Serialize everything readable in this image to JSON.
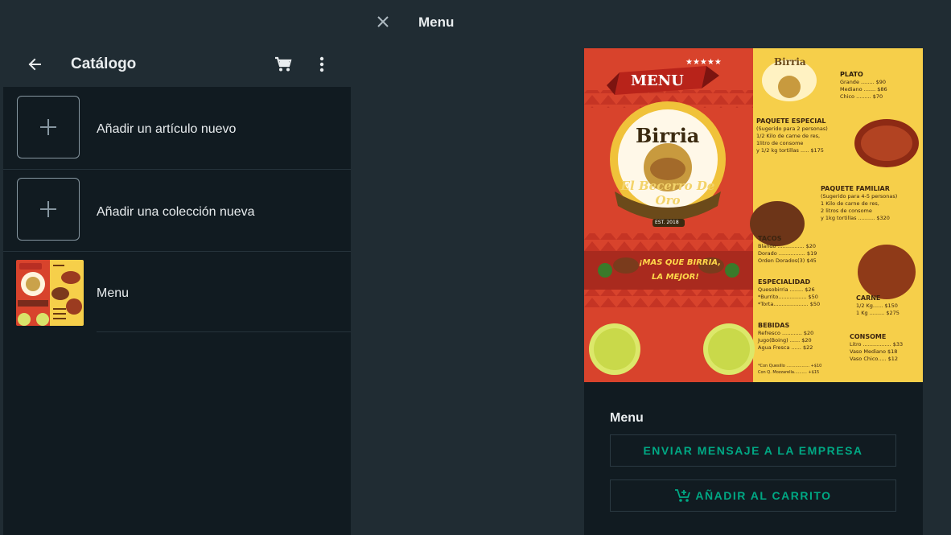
{
  "viewer": {
    "title": "Menu",
    "close_icon": "close-icon"
  },
  "catalog": {
    "title": "Catálogo",
    "back_icon": "arrow-left-icon",
    "cart_icon": "cart-icon",
    "more_icon": "more-vertical-icon",
    "items": [
      {
        "label": "Añadir un artículo nuevo",
        "icon": "plus-icon"
      },
      {
        "label": "Añadir una colección nueva",
        "icon": "plus-icon"
      },
      {
        "label": "Menu"
      }
    ]
  },
  "menu_image": {
    "banner": "MENU",
    "brand": "Birria",
    "brand_sub": "El Becerro De Oro",
    "est": "EST. 2018",
    "slogan_line1": "¡MAS QUE BIRRIA,",
    "slogan_line2": "LA MEJOR!",
    "plato_title": "PLATO",
    "plato_rows": [
      "Grande ........ $90",
      "Mediano ....... $86",
      "Chico ......... $70"
    ],
    "paquete_especial_title": "PAQUETE ESPECIAL",
    "paquete_especial_rows": [
      "(Sugerido para 2 personas)",
      "1/2 Kilo de carne de res,",
      "1litro de consome",
      "y 1/2 kg tortillas ..... $175"
    ],
    "paquete_familiar_title": "PAQUETE FAMILIAR",
    "paquete_familiar_rows": [
      "(Sugerido para 4-5 personas)",
      "1 Kilo de carne de res,",
      "2 litros de consome",
      "y 1kg tortillas .......... $320"
    ],
    "tacos_title": "TACOS",
    "tacos_rows": [
      "Blando ................ $20",
      "Dorado ................ $19",
      "Orden Dorados(3) $45"
    ],
    "especialidad_title": "ESPECIALIDAD",
    "especialidad_rows": [
      "Quesobirria ........ $26",
      "*Burrito................. $50",
      "*Torta..................... $50"
    ],
    "carne_title": "CARNE",
    "carne_rows": [
      "1/2 Kg...... $150",
      "1 Kg ......... $275"
    ],
    "bebidas_title": "BEBIDAS",
    "bebidas_rows": [
      "Refresco ............ $20",
      "Jugo(Boing) ...... $20",
      "Agua Fresca ...... $22"
    ],
    "consome_title": "CONSOME",
    "consome_rows": [
      "Litro ................. $33",
      "Vaso Mediano $18",
      "Vaso Chico..... $12"
    ],
    "extras_rows": [
      "*Con Quesillo .................. +$10",
      "Con Q. Mozzarella.......... +$15"
    ]
  },
  "product": {
    "title": "Menu",
    "message_button": "ENVIAR MENSAJE A LA EMPRESA",
    "cart_button": "AÑADIR AL CARRITO",
    "cart_button_icon": "add-to-cart-icon"
  },
  "colors": {
    "accent": "#00a884",
    "panel": "#111b21",
    "header": "#202c33",
    "menu_red": "#d8432c",
    "menu_yellow": "#f6cf4a"
  }
}
